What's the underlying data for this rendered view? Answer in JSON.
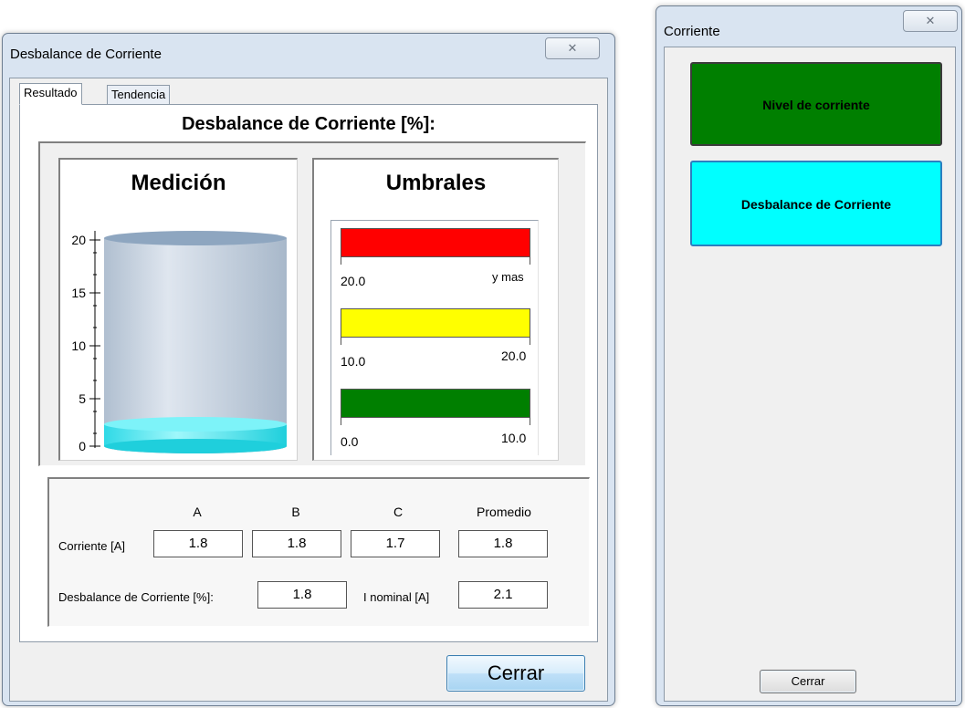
{
  "window_main": {
    "title": "Desbalance de Corriente",
    "close_icon": "✕",
    "tabs": [
      {
        "label": "Resultado",
        "active": true
      },
      {
        "label": "Tendencia",
        "active": false
      }
    ],
    "heading": "Desbalance de Corriente [%]:",
    "measurement": {
      "title": "Medición",
      "axis_ticks": [
        "20",
        "15",
        "10",
        "5",
        "0"
      ],
      "axis_min": 0,
      "axis_max": 20,
      "fill_value": 1.8,
      "fill_color": "#33eaf5"
    },
    "thresholds": {
      "title": "Umbrales",
      "bands": [
        {
          "color": "#ff0000",
          "left_label": "20.0",
          "right_label": "y mas"
        },
        {
          "color": "#ffff00",
          "left_label": "10.0",
          "right_label": "20.0"
        },
        {
          "color": "#007f00",
          "left_label": "0.0",
          "right_label": "10.0"
        }
      ]
    },
    "values": {
      "col_a": "A",
      "col_b": "B",
      "col_c": "C",
      "col_avg": "Promedio",
      "current_label": "Corriente [A]",
      "current_a": "1.8",
      "current_b": "1.8",
      "current_c": "1.7",
      "current_avg": "1.8",
      "unbalance_label": "Desbalance de Corriente [%]:",
      "unbalance_value": "1.8",
      "nominal_label": "I nominal [A]",
      "nominal_value": "2.1"
    },
    "close_button": "Cerrar"
  },
  "window_side": {
    "title": "Corriente",
    "close_icon": "✕",
    "buttons": [
      {
        "label": "Nivel de corriente",
        "color": "#007f00"
      },
      {
        "label": "Desbalance de Corriente",
        "color": "#00ffff"
      }
    ],
    "close_button": "Cerrar"
  }
}
